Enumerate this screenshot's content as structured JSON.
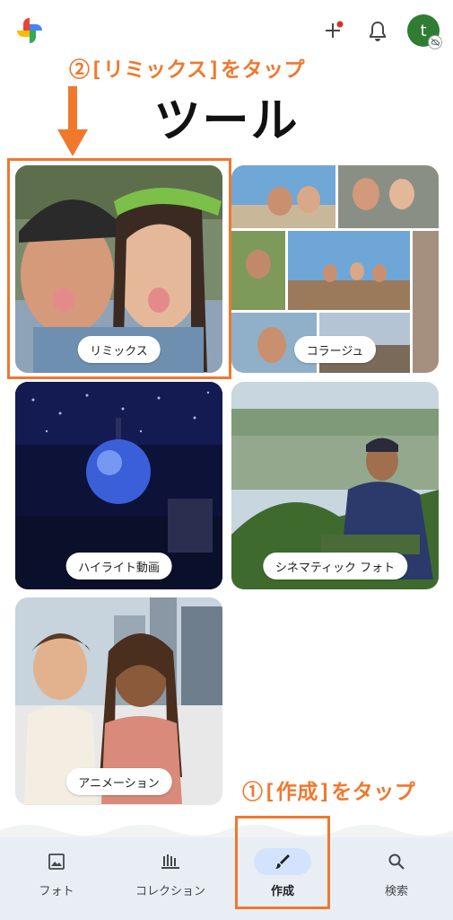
{
  "app": {
    "name": "Google Photos"
  },
  "header": {
    "avatar_initial": "t"
  },
  "annotations": {
    "step2": "②[リミックス]をタップ",
    "step1": "①[作成]をタップ",
    "color": "#f0782d"
  },
  "page": {
    "title": "ツール"
  },
  "tiles": [
    {
      "label": "リミックス"
    },
    {
      "label": "コラージュ"
    },
    {
      "label": "ハイライト動画"
    },
    {
      "label": "シネマティック フォト"
    },
    {
      "label": "アニメーション"
    }
  ],
  "bottom_nav": {
    "active": "作成",
    "items": [
      {
        "label": "フォト",
        "icon": "photo-icon"
      },
      {
        "label": "コレクション",
        "icon": "collections-icon"
      },
      {
        "label": "作成",
        "icon": "brush-icon"
      },
      {
        "label": "検索",
        "icon": "search-icon"
      }
    ]
  },
  "colors": {
    "accent": "#f0782d",
    "nav_background": "#e9eef4",
    "active_pill": "#d3e3fd",
    "avatar": "#2e7d32"
  }
}
